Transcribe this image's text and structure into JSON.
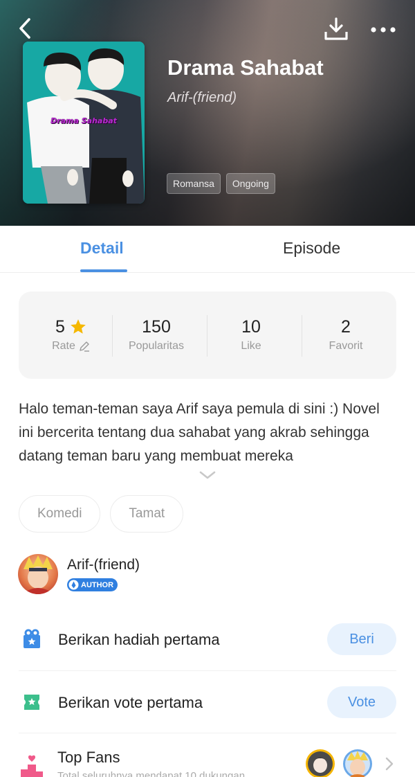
{
  "header": {
    "title": "Drama Sahabat",
    "author": "Arif-(friend)",
    "cover_title": "Drama Sahabat",
    "tags": [
      "Romansa",
      "Ongoing"
    ],
    "icons": [
      "back-icon",
      "download-icon",
      "more-icon"
    ]
  },
  "tabs": [
    {
      "label": "Detail",
      "active": true
    },
    {
      "label": "Episode",
      "active": false
    }
  ],
  "stats": [
    {
      "value": "5",
      "label": "Rate",
      "icon": "star-icon",
      "label_icon": "edit-icon"
    },
    {
      "value": "150",
      "label": "Popularitas"
    },
    {
      "value": "10",
      "label": "Like"
    },
    {
      "value": "2",
      "label": "Favorit"
    }
  ],
  "description": "Halo teman-teman saya Arif saya pemula di sini :) Novel ini bercerita tentang dua sahabat yang akrab sehingga datang teman baru yang membuat mereka",
  "categories": [
    "Komedi",
    "Tamat"
  ],
  "author_section": {
    "name": "Arif-(friend)",
    "badge": "AUTHOR"
  },
  "actions": {
    "gift": {
      "label": "Berikan hadiah pertama",
      "button": "Beri"
    },
    "vote": {
      "label": "Berikan vote pertama",
      "button": "Vote"
    },
    "fans": {
      "label": "Top Fans",
      "subtitle": "Total seluruhnya mendapat 10 dukungan"
    }
  },
  "colors": {
    "accent": "#4a90e2",
    "button_bg": "#e8f2fd",
    "gift_icon": "#3d8ce6",
    "vote_icon": "#3cbf8c",
    "fans_icon": "#f05a8a",
    "star": "#f5b800"
  }
}
